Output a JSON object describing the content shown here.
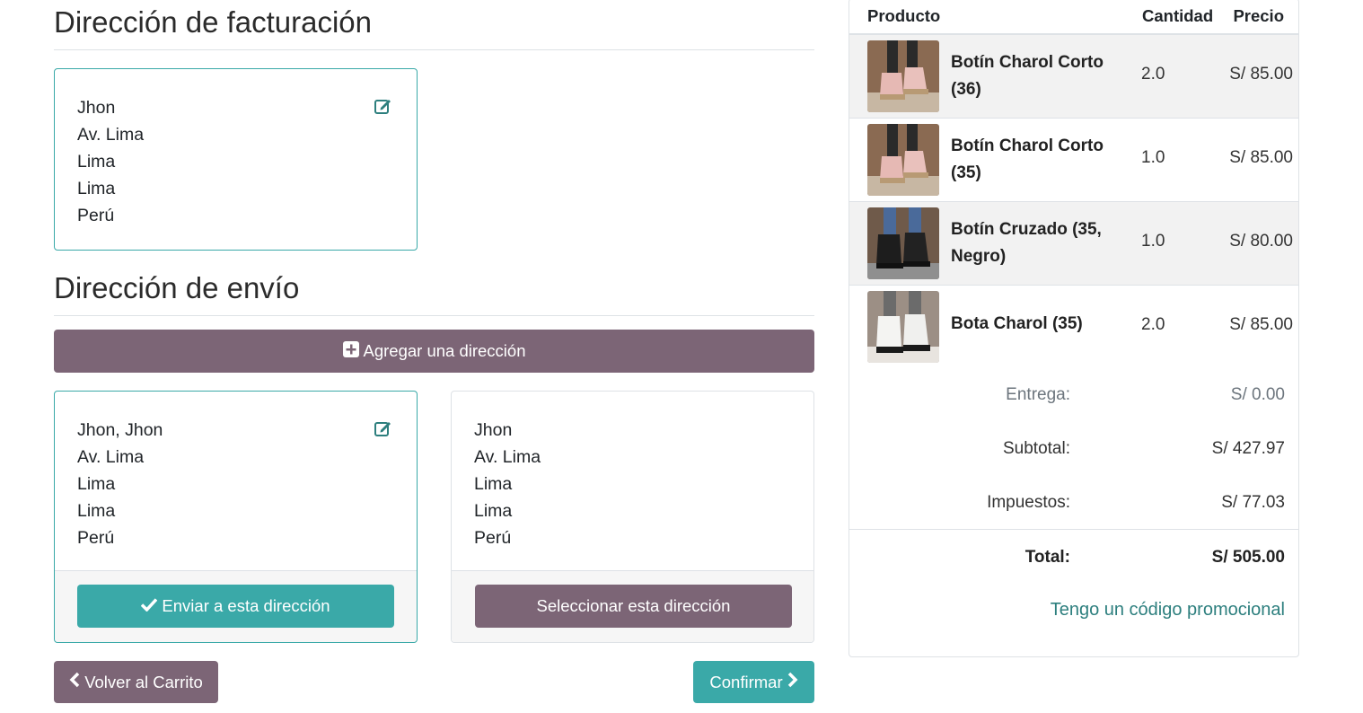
{
  "billing": {
    "title": "Dirección de facturación",
    "address": {
      "lines": [
        "Jhon",
        "Av. Lima",
        "Lima",
        "Lima",
        "Perú"
      ]
    }
  },
  "shipping": {
    "title": "Dirección de envío",
    "add_button": "Agregar una dirección",
    "addresses": [
      {
        "lines": [
          "Jhon, Jhon",
          "Av. Lima",
          "Lima",
          "Lima",
          "Perú"
        ],
        "button": "Enviar a esta dirección",
        "selected": true
      },
      {
        "lines": [
          "Jhon",
          "Av. Lima",
          "Lima",
          "Lima",
          "Perú"
        ],
        "button": "Seleccionar esta dirección",
        "selected": false
      }
    ]
  },
  "nav": {
    "back": "Volver al Carrito",
    "confirm": "Confirmar"
  },
  "cart": {
    "headers": {
      "product": "Producto",
      "quantity": "Cantidad",
      "price": "Precio"
    },
    "items": [
      {
        "name": "Botín Charol Corto (36)",
        "qty": "2.0",
        "price": "S/ 85.00"
      },
      {
        "name": "Botín Charol Corto (35)",
        "qty": "1.0",
        "price": "S/ 85.00"
      },
      {
        "name": "Botín Cruzado (35, Negro)",
        "qty": "1.0",
        "price": "S/ 80.00"
      },
      {
        "name": "Bota Charol (35)",
        "qty": "2.0",
        "price": "S/ 85.00"
      }
    ],
    "summary": {
      "delivery_label": "Entrega:",
      "delivery": "S/ 0.00",
      "subtotal_label": "Subtotal:",
      "subtotal": "S/ 427.97",
      "taxes_label": "Impuestos:",
      "taxes": "S/ 77.03",
      "total_label": "Total:",
      "total": "S/ 505.00"
    },
    "promo": "Tengo un código promocional"
  },
  "colors": {
    "primary": "#7c6576",
    "accent": "#3aa9a8",
    "link": "#2d7f7e"
  }
}
